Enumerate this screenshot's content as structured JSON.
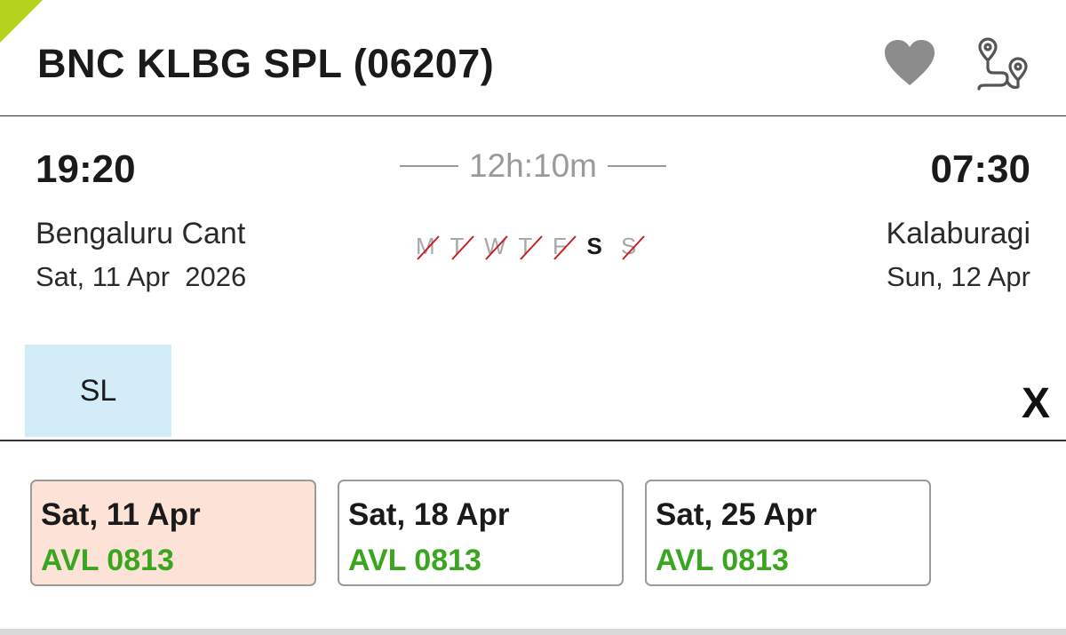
{
  "train": {
    "title": "BNC KLBG SPL (06207)"
  },
  "colors": {
    "accent_flag": "#b5d31c",
    "available": "#3aa51e",
    "selected_bg": "#fde3d7",
    "class_chip_bg": "#d4ecf8"
  },
  "icons": {
    "favorite": "heart-icon",
    "route": "route-map-icon",
    "close": "close-icon"
  },
  "departure": {
    "time": "19:20",
    "station": "Bengaluru Cant",
    "date": "Sat, 11 Apr  2026"
  },
  "arrival": {
    "time": "07:30",
    "station": "Kalaburagi",
    "date": "Sun, 12 Apr"
  },
  "duration": "12h:10m",
  "run_days": [
    {
      "label": "M",
      "runs": false
    },
    {
      "label": "T",
      "runs": false
    },
    {
      "label": "W",
      "runs": false
    },
    {
      "label": "T",
      "runs": false
    },
    {
      "label": "F",
      "runs": false
    },
    {
      "label": "S",
      "runs": true
    },
    {
      "label": "S",
      "runs": false
    }
  ],
  "class_label": "SL",
  "close_label": "X",
  "availability": [
    {
      "date": "Sat, 11 Apr",
      "status": "AVL 0813",
      "selected": true
    },
    {
      "date": "Sat, 18 Apr",
      "status": "AVL 0813",
      "selected": false
    },
    {
      "date": "Sat, 25 Apr",
      "status": "AVL 0813",
      "selected": false
    }
  ]
}
